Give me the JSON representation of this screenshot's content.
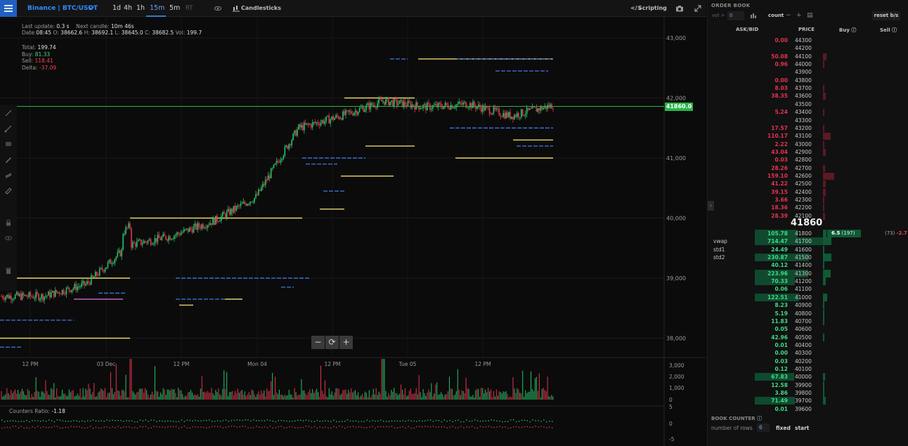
{
  "toolbar": {
    "pair_label": "Binance | BTC/USDT",
    "timeframes": [
      "1d",
      "4h",
      "1h",
      "15m",
      "5m",
      "RT"
    ],
    "active_timeframe": "15m",
    "chart_type_label": "Candlesticks",
    "scripting_label": "Scripting"
  },
  "info": {
    "last_update_label": "Last update:",
    "last_update_value": "0.3 s",
    "next_candle_label": "Next candle:",
    "next_candle_value": "10m 46s",
    "date_label": "Date:",
    "date_value": "08:45",
    "open_label": "O:",
    "open_value": "38662.6",
    "high_label": "H:",
    "high_value": "38692.1",
    "low_label": "L:",
    "low_value": "38645.0",
    "close_label": "C:",
    "close_value": "38682.5",
    "vol_label": "Vol:",
    "vol_value": "199.7",
    "total_label": "Total:",
    "total_value": "199.74",
    "buy_label": "Buy:",
    "buy_value": "81.33",
    "sell_label": "Sell:",
    "sell_value": "118.41",
    "delta_label": "Delta:",
    "delta_value": "-37.09"
  },
  "chart": {
    "y_ticks": [
      "43,000",
      "42,000",
      "41,000",
      "40,000",
      "39,000",
      "38,000"
    ],
    "x_ticks": [
      "12 PM",
      "03 Dec",
      "12 PM",
      "Mon 04",
      "12 PM",
      "Tue 05",
      "12 PM"
    ],
    "volume_ticks": [
      "3,000",
      "2,000",
      "1,000",
      "0"
    ],
    "ratio_ticks": [
      "5",
      "0",
      "-5"
    ],
    "current_price_tag": "41860.0",
    "counters_ratio_label": "Counters Ratio:",
    "counters_ratio_value": "-1.18",
    "colors": {
      "up": "#26c46a",
      "down": "#e8334f",
      "price_line": "#2bb34a",
      "level_yellow": "#e8d76b",
      "level_blue": "#3b6fd1"
    }
  },
  "chart_data": {
    "type": "line",
    "title": "",
    "xlabel": "",
    "ylabel": "",
    "ylim": [
      37700,
      43100
    ],
    "x": [
      "12 PM",
      "03 Dec",
      "12 PM",
      "Mon 04",
      "12 PM",
      "Tue 05",
      "12 PM"
    ],
    "series": [
      {
        "values": [
          38700,
          38700,
          38900,
          39550,
          39700,
          39950,
          40350,
          41500,
          41700,
          41950,
          41850,
          41900,
          41700,
          41880
        ]
      }
    ]
  },
  "orderbook": {
    "title": "ORDER BOOK",
    "vol_label": "vol >",
    "vol_value": "0",
    "count_label": "count",
    "reset_label": "reset b/s",
    "col_askbid": "ASK/BID",
    "col_price": "PRICE",
    "col_buy": "Buy",
    "col_sell": "Sell",
    "mid_price": "41860",
    "buy_cell_value": "6.5",
    "buy_cell_count": "(197)",
    "sell_cell_count": "(73)",
    "sell_cell_value": "-2.7",
    "asks": [
      {
        "price": "44300",
        "qty": "0.00"
      },
      {
        "price": "44200",
        "qty": ""
      },
      {
        "price": "44100",
        "qty": "50.08"
      },
      {
        "price": "44000",
        "qty": "0.96"
      },
      {
        "price": "43900",
        "qty": ""
      },
      {
        "price": "43800",
        "qty": "0.00"
      },
      {
        "price": "43700",
        "qty": "8.03"
      },
      {
        "price": "43600",
        "qty": "38.35"
      },
      {
        "price": "43500",
        "qty": ""
      },
      {
        "price": "43400",
        "qty": "5.24"
      },
      {
        "price": "43300",
        "qty": ""
      },
      {
        "price": "43200",
        "qty": "17.57"
      },
      {
        "price": "43100",
        "qty": "110.17"
      },
      {
        "price": "43000",
        "qty": "2.22"
      },
      {
        "price": "42900",
        "qty": "43.04"
      },
      {
        "price": "42800",
        "qty": "0.03"
      },
      {
        "price": "42700",
        "qty": "28.26"
      },
      {
        "price": "42600",
        "qty": "159.10"
      },
      {
        "price": "42500",
        "qty": "41.22"
      },
      {
        "price": "42400",
        "qty": "39.15"
      },
      {
        "price": "42300",
        "qty": "3.66"
      },
      {
        "price": "42200",
        "qty": "18.36"
      },
      {
        "price": "42100",
        "qty": "28.39"
      }
    ],
    "bids": [
      {
        "price": "41800",
        "qty": "105.78",
        "label": ""
      },
      {
        "price": "41700",
        "qty": "714.47",
        "label": "vwap"
      },
      {
        "price": "41600",
        "qty": "24.49",
        "label": "std1"
      },
      {
        "price": "41500",
        "qty": "230.87",
        "label": "std2"
      },
      {
        "price": "41400",
        "qty": "40.12",
        "label": ""
      },
      {
        "price": "41300",
        "qty": "223.96",
        "label": ""
      },
      {
        "price": "41200",
        "qty": "70.33",
        "label": ""
      },
      {
        "price": "41100",
        "qty": "0.06",
        "label": ""
      },
      {
        "price": "41000",
        "qty": "122.51",
        "label": ""
      },
      {
        "price": "40900",
        "qty": "8.23",
        "label": ""
      },
      {
        "price": "40800",
        "qty": "5.19",
        "label": ""
      },
      {
        "price": "40700",
        "qty": "11.83",
        "label": ""
      },
      {
        "price": "40600",
        "qty": "0.05",
        "label": ""
      },
      {
        "price": "40500",
        "qty": "42.96",
        "label": ""
      },
      {
        "price": "40400",
        "qty": "0.01",
        "label": ""
      },
      {
        "price": "40300",
        "qty": "0.00",
        "label": ""
      },
      {
        "price": "40200",
        "qty": "0.03",
        "label": ""
      },
      {
        "price": "40100",
        "qty": "0.12",
        "label": ""
      },
      {
        "price": "40000",
        "qty": "67.83",
        "label": ""
      },
      {
        "price": "39900",
        "qty": "12.58",
        "label": ""
      },
      {
        "price": "39800",
        "qty": "3.86",
        "label": ""
      },
      {
        "price": "39700",
        "qty": "71.49",
        "label": ""
      },
      {
        "price": "39600",
        "qty": "0.01",
        "label": ""
      }
    ]
  },
  "book_counter": {
    "title": "BOOK COUNTER",
    "rows_label": "number of rows",
    "rows_value": "6",
    "fixed_label": "fixed",
    "start_label": "start"
  }
}
